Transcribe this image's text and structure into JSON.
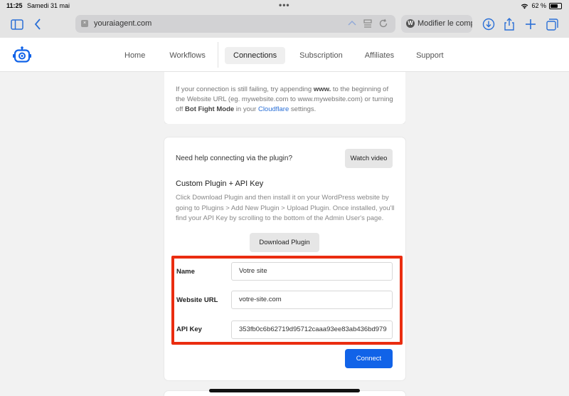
{
  "status": {
    "time": "11:25",
    "date": "Samedi 31 mai",
    "battery": "62 %"
  },
  "browser": {
    "url": "youraiagent.com",
    "other_tab_title": "Modifier le comp"
  },
  "nav": {
    "items": [
      {
        "label": "Home"
      },
      {
        "label": "Workflows"
      },
      {
        "label": "Connections",
        "active": true
      },
      {
        "label": "Subscription"
      },
      {
        "label": "Affiliates"
      },
      {
        "label": "Support"
      }
    ]
  },
  "troubleshoot": {
    "text_before": "If your connection is still failing, try appending ",
    "bold1": "www.",
    "text_mid": " to the beginning of the Website URL (eg. mywebsite.com to www.mywebsite.com) or turning off ",
    "bold2": "Bot Fight Mode",
    "text_mid2": " in your ",
    "link": "Cloudflare",
    "text_after": " settings."
  },
  "plugin": {
    "help_text": "Need help connecting via the plugin?",
    "watch_video": "Watch video",
    "title": "Custom Plugin + API Key",
    "description": "Click Download Plugin and then install it on your WordPress website by going to Plugins > Add New Plugin > Upload Plugin. Once installed, you'll find your API Key by scrolling to the bottom of the Admin User's page.",
    "download_button": "Download Plugin",
    "fields": {
      "name_label": "Name",
      "name_value": "Votre site",
      "website_label": "Website URL",
      "website_value": "votre-site.com",
      "apikey_label": "API Key",
      "apikey_value": "353fb0c6b62719d95712caaa93ee83ab436bd979"
    },
    "connect_button": "Connect"
  },
  "colors": {
    "accent": "#1163e8",
    "highlight": "#ea2d10",
    "link": "#2a6fd6"
  }
}
